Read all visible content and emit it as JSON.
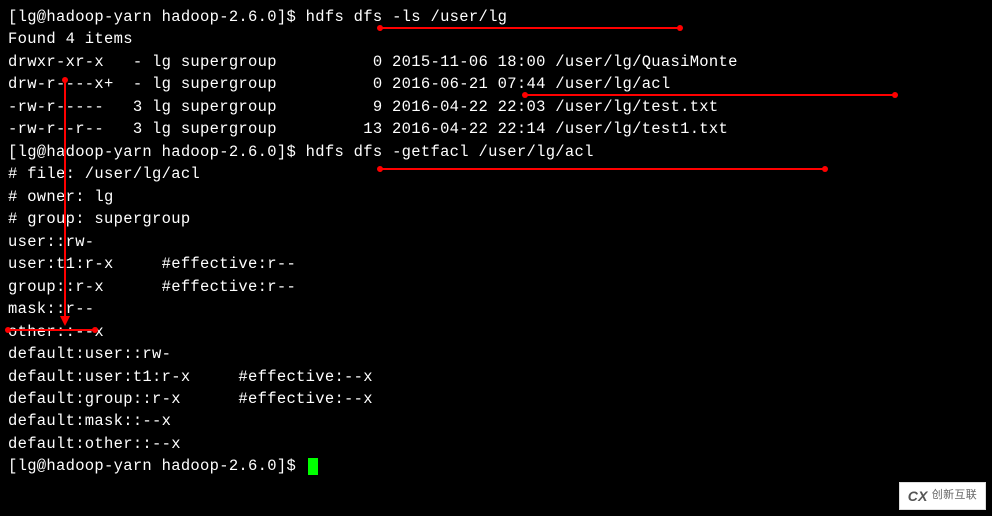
{
  "prompt1": "[lg@hadoop-yarn hadoop-2.6.0]$ ",
  "cmd1": "hdfs dfs -ls /user/lg",
  "found": "Found 4 items",
  "ls": [
    "drwxr-xr-x   - lg supergroup          0 2015-11-06 18:00 /user/lg/QuasiMonte",
    "drw-r----x+  - lg supergroup          0 2016-06-21 07:44 /user/lg/acl",
    "-rw-r-----   3 lg supergroup          9 2016-04-22 22:03 /user/lg/test.txt",
    "-rw-r--r--   3 lg supergroup         13 2016-04-22 22:14 /user/lg/test1.txt"
  ],
  "prompt2": "[lg@hadoop-yarn hadoop-2.6.0]$ ",
  "cmd2": "hdfs dfs -getfacl /user/lg/acl",
  "acl": [
    "# file: /user/lg/acl",
    "# owner: lg",
    "# group: supergroup",
    "user::rw-",
    "user:t1:r-x     #effective:r--",
    "group::r-x      #effective:r--",
    "mask::r--",
    "other::--x",
    "default:user::rw-",
    "default:user:t1:r-x     #effective:--x",
    "default:group::r-x      #effective:--x",
    "default:mask::--x",
    "default:other::--x"
  ],
  "blank": "",
  "prompt3": "[lg@hadoop-yarn hadoop-2.6.0]$ ",
  "watermark": {
    "logo": "CX",
    "text": "创新互联"
  }
}
